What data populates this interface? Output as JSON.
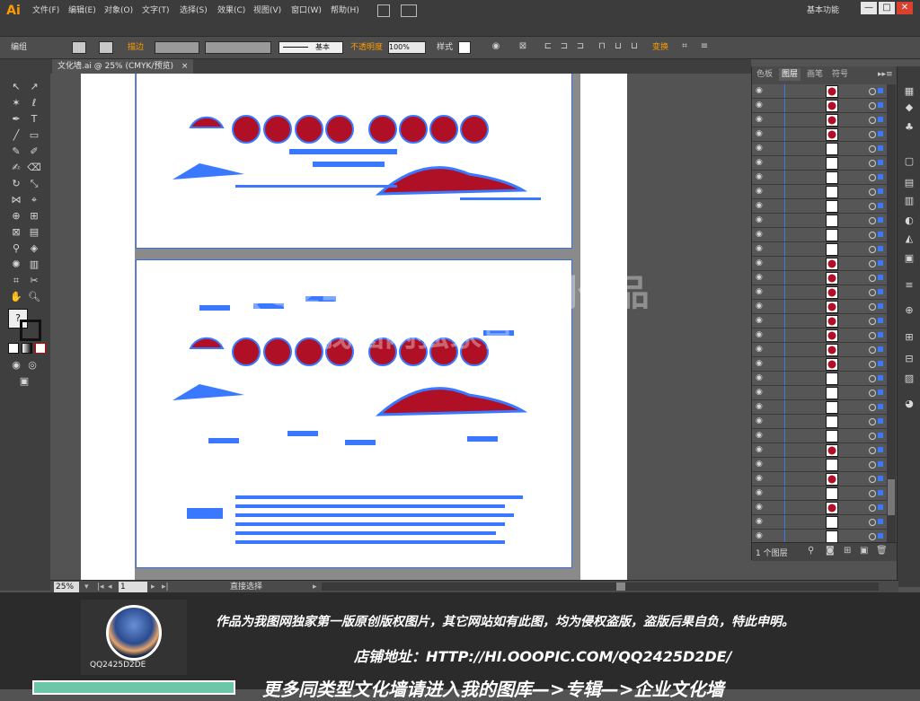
{
  "app": {
    "logo": "Ai",
    "menu": [
      "文件(F)",
      "编辑(E)",
      "对象(O)",
      "文字(T)",
      "选择(S)",
      "效果(C)",
      "视图(V)",
      "窗口(W)",
      "帮助(H)"
    ],
    "workspace": "基本功能",
    "window_controls": [
      "—",
      "□",
      "✕"
    ]
  },
  "control_bar": {
    "mode_label": "编组",
    "stroke_label": "描边",
    "basic_label": "基本",
    "opacity_label": "不透明度",
    "opacity_value": "100%",
    "style_label": "样式",
    "transform_label": "变换"
  },
  "document": {
    "tab_title": "文化墙.ai @ 25% (CMYK/预览)",
    "tab_close": "×"
  },
  "layers_panel": {
    "tabs": [
      "色板",
      "图层",
      "画笔",
      "符号"
    ],
    "active_tab": "图层",
    "footer_count": "1 个图层"
  },
  "status_bar": {
    "zoom": "25%",
    "artboard_number": "1",
    "tool_name": "直接选择"
  },
  "watermark": {
    "line1": "QQ2425D2DE原创作品",
    "line2": "我图网独家首发"
  },
  "banner": {
    "notice": "作品为我图网独家第一版原创版权图片，其它网站如有此图，均为侵权盗版，盗版后果自负，特此申明。",
    "shop": "店铺地址：HTTP://HI.OOOPIC.COM/QQ2425D2DE/",
    "more": "更多同类型文化墙请进入我的图库—>专辑—>企业文化墙",
    "username": "QQ2425D2DE"
  },
  "colors": {
    "accent_orange": "#ff9a00",
    "selection_blue": "#3a78ff",
    "art_red": "#b01025"
  }
}
